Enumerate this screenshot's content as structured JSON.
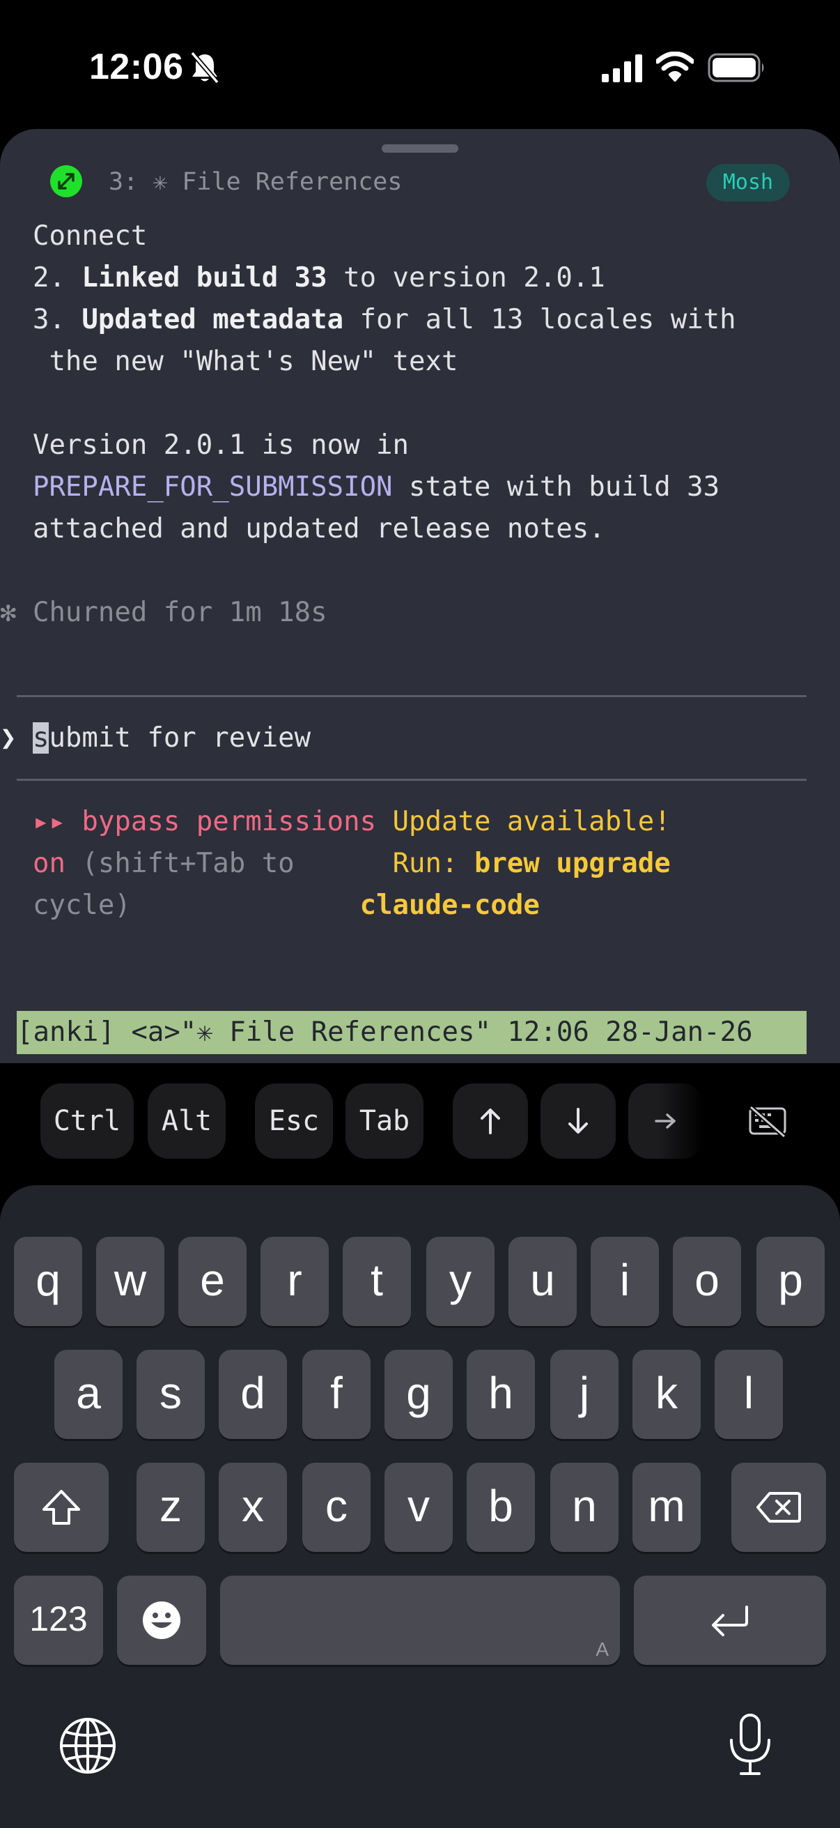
{
  "status_bar": {
    "time": "12:06"
  },
  "terminal": {
    "tab_title": "3: ✳ File References",
    "badge": "Mosh",
    "lines": {
      "l1": "Connect",
      "l2_prefix": "2. ",
      "l2_bold": "Linked build 33",
      "l2_rest": " to version 2.0.1",
      "l3_prefix": "3. ",
      "l3_bold": "Updated metadata",
      "l3_rest": " for all 13 locales with",
      "l4": " the new \"What's New\" text",
      "l5": "Version 2.0.1 is now in",
      "l6_hl": "PREPARE_FOR_SUBMISSION",
      "l6_rest": " state with build 33",
      "l7": "attached and updated release notes."
    },
    "churn": {
      "glyph": "✻",
      "text": "Churned for 1m 18s"
    },
    "prompt": {
      "glyph": "❯",
      "cursor_char": "s",
      "rest": "ubmit for review"
    },
    "footer": {
      "left_arrows": "▸▸",
      "left_1": " bypass permissions",
      "left_2_red": "on",
      "left_2_rest": " (shift+Tab to",
      "left_3": "cycle)",
      "right_1": "Update available!",
      "right_2_label": "Run: ",
      "right_2_cmd": "brew upgrade",
      "right_3_cmd": "claude-code"
    },
    "tmux_status": "[anki] <a>\"✳ File References\" 12:06 28-Jan-26"
  },
  "toolbar": {
    "ctrl": "Ctrl",
    "alt": "Alt",
    "esc": "Esc",
    "tab": "Tab",
    "icons": [
      "arrow-up-icon",
      "arrow-down-icon",
      "arrow-right-icon",
      "keyboard-dismiss-icon"
    ]
  },
  "keyboard": {
    "row1": [
      "q",
      "w",
      "e",
      "r",
      "t",
      "y",
      "u",
      "i",
      "o",
      "p"
    ],
    "row2": [
      "a",
      "s",
      "d",
      "f",
      "g",
      "h",
      "j",
      "k",
      "l"
    ],
    "row3": [
      "z",
      "x",
      "c",
      "v",
      "b",
      "n",
      "m"
    ],
    "numbers_label": "123",
    "space_hint": "A"
  },
  "colors": {
    "terminal_bg": "#2d2f3a",
    "accent_green": "#20e02c",
    "badge_teal": "#26cfb8",
    "highlight_lavender": "#b7b1ee",
    "warning_pink": "#ef6a84",
    "update_yellow": "#f4c63a",
    "tmux_green": "#a6c48e"
  }
}
